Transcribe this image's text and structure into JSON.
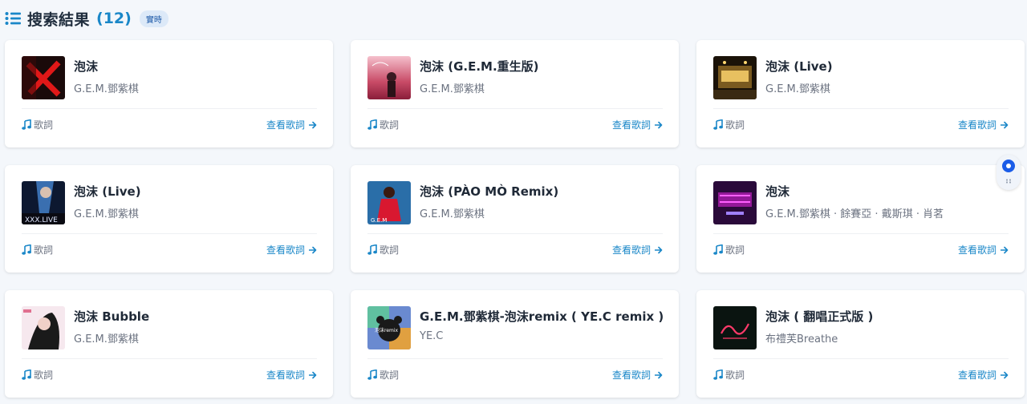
{
  "header": {
    "title": "搜索結果",
    "count": "(12)",
    "badge": "實時"
  },
  "colors": {
    "accent": "#1a87c8",
    "badge_bg": "#dce9f8",
    "page_bg": "#f4f7fb"
  },
  "results": [
    {
      "title": "泡沫",
      "artist": "G.E.M.鄧紫棋",
      "lyrics_label": "歌詞",
      "view_label": "查看歌詞",
      "cover": "red-x-dark"
    },
    {
      "title": "泡沫 (G.E.M.重生版)",
      "artist": "G.E.M.鄧紫棋",
      "lyrics_label": "歌詞",
      "view_label": "查看歌詞",
      "cover": "pink-sunset"
    },
    {
      "title": "泡沫 (Live)",
      "artist": "G.E.M.鄧紫棋",
      "lyrics_label": "歌詞",
      "view_label": "查看歌詞",
      "cover": "gold-stage"
    },
    {
      "title": "泡沫 (Live)",
      "artist": "G.E.M.鄧紫棋",
      "lyrics_label": "歌詞",
      "view_label": "查看歌詞",
      "cover": "xxx-live-blue"
    },
    {
      "title": "泡沫 (PÀO MÒ Remix)",
      "artist": "G.E.M.鄧紫棋",
      "lyrics_label": "歌詞",
      "view_label": "查看歌詞",
      "cover": "red-dress-blue"
    },
    {
      "title": "泡沫",
      "artist": "G.E.M.鄧紫棋 · 餘賽亞 · 戴斯琪 · 肖茗",
      "lyrics_label": "歌詞",
      "view_label": "查看歌詞",
      "cover": "neon-purple"
    },
    {
      "title": "泡沫 Bubble",
      "artist": "G.E.M.鄧紫棋",
      "lyrics_label": "歌詞",
      "view_label": "查看歌詞",
      "cover": "pink-portrait"
    },
    {
      "title": "G.E.M.鄧紫棋-泡沫remix ( YE.C remix )",
      "artist": "YE.C",
      "lyrics_label": "歌詞",
      "view_label": "查看歌詞",
      "cover": "bear-colorful"
    },
    {
      "title": "泡沫 ( 翻唱正式版 )",
      "artist": "布禮芙Breathe",
      "lyrics_label": "歌詞",
      "view_label": "查看歌詞",
      "cover": "breathe-dark"
    }
  ],
  "icons": {
    "header": "list-icon",
    "lyrics": "music-note-icon",
    "link": "arrow-right-icon",
    "floating": "floating-assistant-icon"
  }
}
